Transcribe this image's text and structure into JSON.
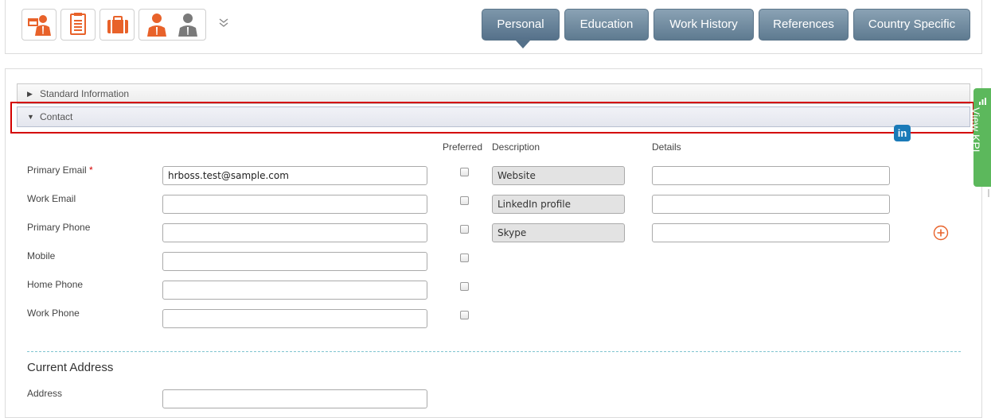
{
  "toolbar": {
    "icons": [
      "employee-card-icon",
      "document-list-icon",
      "briefcase-icon",
      "people-switch-icon"
    ],
    "more_icon": "double-chevron-down-icon",
    "tabs": [
      {
        "label": "Personal",
        "active": true
      },
      {
        "label": "Education",
        "active": false
      },
      {
        "label": "Work History",
        "active": false
      },
      {
        "label": "References",
        "active": false
      },
      {
        "label": "Country Specific",
        "active": false
      }
    ]
  },
  "sections": {
    "standard": {
      "title": "Standard Information",
      "expanded": false
    },
    "contact": {
      "title": "Contact",
      "expanded": true
    }
  },
  "contact": {
    "headers": {
      "preferred": "Preferred",
      "description": "Description",
      "details": "Details"
    },
    "fields": [
      {
        "label": "Primary Email",
        "required_mark": "*",
        "value": "hrboss.test@sample.com"
      },
      {
        "label": "Work Email",
        "value": ""
      },
      {
        "label": "Primary Phone",
        "value": ""
      },
      {
        "label": "Mobile",
        "value": ""
      },
      {
        "label": "Home Phone",
        "value": ""
      },
      {
        "label": "Work Phone",
        "value": ""
      }
    ],
    "links": [
      {
        "description": "Website",
        "details": ""
      },
      {
        "description": "LinkedIn profile",
        "details": ""
      },
      {
        "description": "Skype",
        "details": ""
      }
    ],
    "linkedin_icon": "in"
  },
  "address": {
    "title": "Current Address",
    "address_label": "Address",
    "address_value": ""
  },
  "kpi": {
    "label": "View KPI"
  },
  "colors": {
    "accent_orange": "#e8622a",
    "tab_blue": "#6a859a",
    "highlight_red": "#d40000",
    "kpi_green": "#5cb85c",
    "linkedin_blue": "#1a7ab8"
  }
}
